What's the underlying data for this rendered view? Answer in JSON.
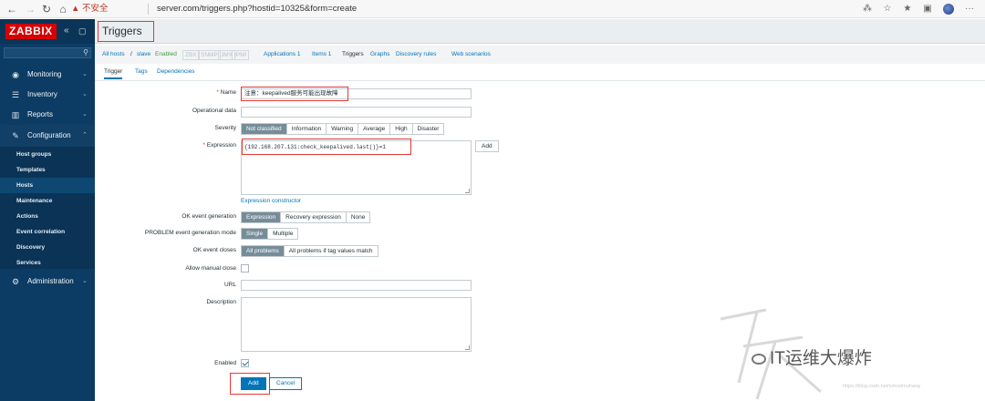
{
  "browser": {
    "security_label": "▲ 不安全",
    "url": "server.com/triggers.php?hostid=10325&form=create"
  },
  "sidebar": {
    "logo": "ZABBIX",
    "menu": [
      {
        "label": "Monitoring",
        "icon": "eye-icon"
      },
      {
        "label": "Inventory",
        "icon": "list-icon"
      },
      {
        "label": "Reports",
        "icon": "bar-chart-icon"
      },
      {
        "label": "Configuration",
        "icon": "wrench-icon"
      },
      {
        "label": "Administration",
        "icon": "gear-icon"
      }
    ],
    "submenu": [
      "Host groups",
      "Templates",
      "Hosts",
      "Maintenance",
      "Actions",
      "Event correlation",
      "Discovery",
      "Services"
    ],
    "active_submenu": "Hosts"
  },
  "header": {
    "title": "Triggers"
  },
  "breadcrumb": {
    "all_hosts": "All hosts",
    "separator": "/",
    "host": "slave",
    "status": "Enabled",
    "badges": [
      "ZBX",
      "SNMP",
      "JMX",
      "IPMI"
    ],
    "links": [
      "Applications 1",
      "Items 1",
      "Triggers",
      "Graphs",
      "Discovery rules",
      "Web scenarios"
    ]
  },
  "tabs": [
    "Trigger",
    "Tags",
    "Dependencies"
  ],
  "form": {
    "name_label": "Name",
    "name_value": "注意：keepalived服务可能出现故障",
    "operational_data_label": "Operational data",
    "operational_data_value": "",
    "severity_label": "Severity",
    "severity_options": [
      "Not classified",
      "Information",
      "Warning",
      "Average",
      "High",
      "Disaster"
    ],
    "severity_selected": "Not classified",
    "expression_label": "Expression",
    "expression_value": "{192.168.207.131:check_keepalived.last()}=1",
    "add_expression_label": "Add",
    "expression_constructor_label": "Expression constructor",
    "ok_event_generation_label": "OK event generation",
    "ok_event_generation_options": [
      "Expression",
      "Recovery expression",
      "None"
    ],
    "ok_event_generation_selected": "Expression",
    "problem_mode_label": "PROBLEM event generation mode",
    "problem_mode_options": [
      "Single",
      "Multiple"
    ],
    "problem_mode_selected": "Single",
    "ok_event_closes_label": "OK event closes",
    "ok_event_closes_options": [
      "All problems",
      "All problems if tag values match"
    ],
    "ok_event_closes_selected": "All problems",
    "allow_manual_close_label": "Allow manual close",
    "allow_manual_close": false,
    "url_label": "URL",
    "url_value": "",
    "description_label": "Description",
    "description_value": "",
    "enabled_label": "Enabled",
    "enabled": true,
    "add_button": "Add",
    "cancel_button": "Cancel"
  },
  "watermark": {
    "text": "IT运维大爆炸",
    "url": "https://blog.csdn.net/ximsdmuhang"
  },
  "colors": {
    "sidebar_bg": "#0c3c64",
    "logo_bg": "#d40000",
    "accent": "#0275b8",
    "highlight_border": "#e53935",
    "segment_selected": "#768d99"
  }
}
